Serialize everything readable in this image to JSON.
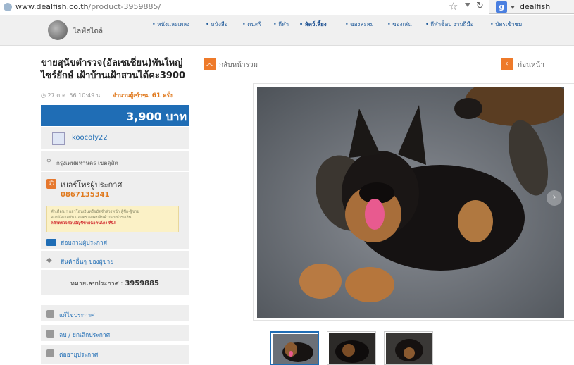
{
  "browser": {
    "url_host": "www.dealfish.co.th",
    "url_path": "/product-3959885/",
    "search_engine_icon": "google-icon",
    "search_engine_letter": "g",
    "search_query": "dealfish"
  },
  "nav": {
    "logo_text": "ไลฟ์สไตล์",
    "items": [
      "หนังและเพลง",
      "หนังสือ",
      "ดนตรี",
      "กีฬา",
      "สัตว์เลี้ยง",
      "ของสะสม",
      "ของเล่น",
      "กีฬาช็อป งานฝีมือ",
      "บัตรเข้าชม"
    ],
    "active_index": 4
  },
  "listing": {
    "title": "ขายสุนัขตำรวจ(อัลเซเชี่ยน)พันใหญ่ ไซร์ยักษ์ เฝ้าบ้านเฝ้าสวนได้คะ3900",
    "posted": "27 ต.ค. 56 10:49 น.",
    "views_label": "จำนวนผู้เข้าชม",
    "views_count": "61",
    "views_unit": "ครั้ง",
    "price": "3,900 บาท",
    "seller": "koocoly22",
    "location": "กรุงเทพมหานคร เขตดุสิต",
    "phone_label": "เบอร์โทรผู้ประกาศ",
    "phone": "0867135341",
    "warning_line1": "คำเตือน!! อย่าโอนเงินหรือมัดจำล่วงหน้า ผู้ซื้อ-ผู้ขาย",
    "warning_line2": "ควรนัดเจอกัน และตรวจสอบสินค้าก่อนชำระเงิน",
    "warning_line3": "คลิกตรวจสอบบัญชีขายฉ้อคนโกง ที่นี่!",
    "contact_link": "สอบถามผู้ประกาศ",
    "other_items_link": "สินค้าอื่นๆ ของผู้ขาย",
    "ad_no_label": "หมายเลขประกาศ :",
    "ad_no": "3959885",
    "actions": [
      "แก้ไขประกาศ",
      "ลบ / ยกเลิกประกาศ",
      "ต่ออายุประกาศ"
    ]
  },
  "gallery": {
    "back_label": "กลับหน้ารวม",
    "prev_label": "ก่อนหน้า",
    "thumbnails": 3,
    "selected_thumbnail": 0
  },
  "colors": {
    "brand_blue": "#1f6db5",
    "accent_orange": "#ee7a2a"
  }
}
